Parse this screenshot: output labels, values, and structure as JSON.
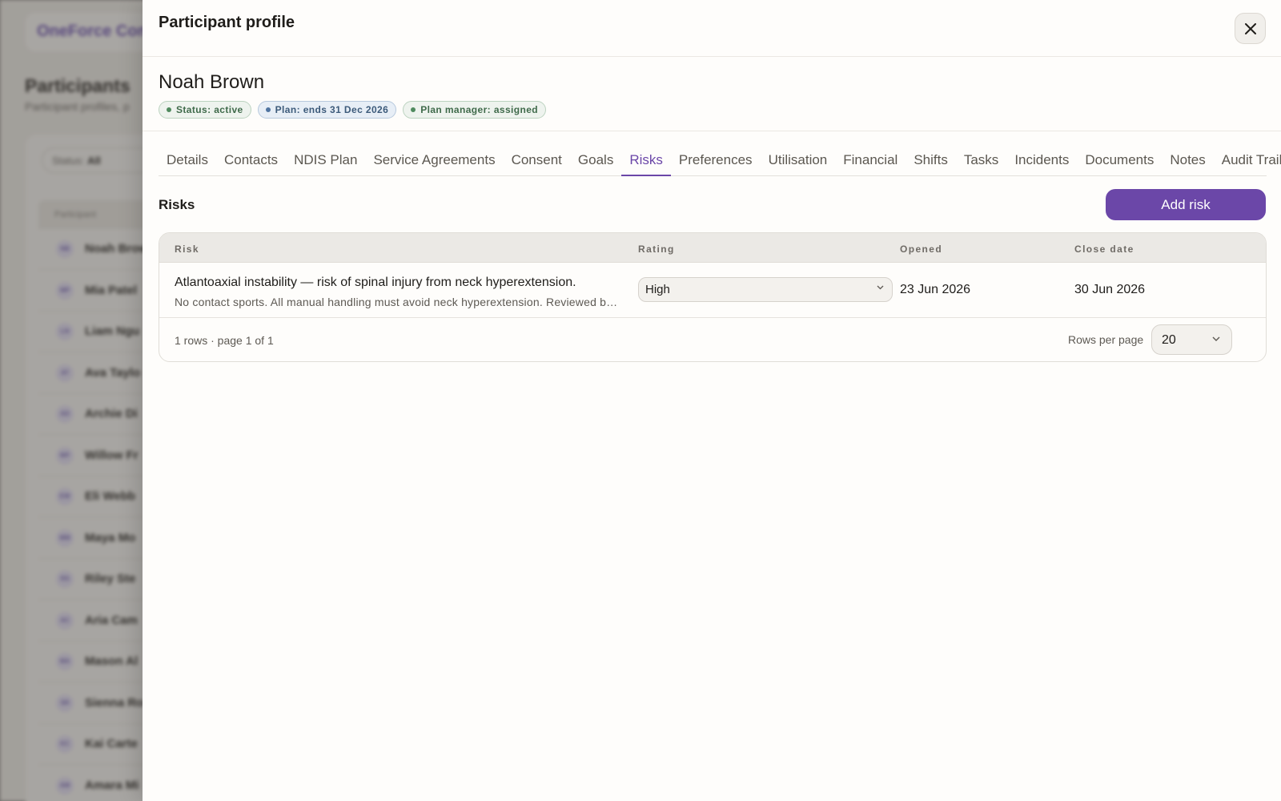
{
  "background": {
    "brand": "OneForce Con",
    "title": "Participants",
    "subtitle": "Participant profiles, p",
    "filter_label": "Status:",
    "filter_value": "All",
    "table_header": "Participant",
    "rows": [
      {
        "initials": "NB",
        "name": "Noah Brow"
      },
      {
        "initials": "MP",
        "name": "Mia Patel"
      },
      {
        "initials": "LN",
        "name": "Liam Ngu"
      },
      {
        "initials": "AT",
        "name": "Ava Taylo"
      },
      {
        "initials": "AD",
        "name": "Archie Di"
      },
      {
        "initials": "WF",
        "name": "Willow Fr"
      },
      {
        "initials": "EW",
        "name": "Eli Webb"
      },
      {
        "initials": "MM",
        "name": "Maya Mo"
      },
      {
        "initials": "RS",
        "name": "Riley Ste"
      },
      {
        "initials": "AC",
        "name": "Aria Cam"
      },
      {
        "initials": "MA",
        "name": "Mason Al"
      },
      {
        "initials": "SR",
        "name": "Sienna Ro"
      },
      {
        "initials": "KC",
        "name": "Kai Carte"
      },
      {
        "initials": "AM",
        "name": "Amara Mi"
      }
    ]
  },
  "drawer": {
    "title": "Participant profile",
    "close_icon": "close-icon",
    "participant_name": "Noah Brown",
    "chips": [
      {
        "label": "Status: active",
        "variant": "green"
      },
      {
        "label": "Plan: ends 31 Dec 2026",
        "variant": "blue"
      },
      {
        "label": "Plan manager: assigned",
        "variant": "green"
      }
    ],
    "tabs": [
      {
        "label": "Details",
        "active": false
      },
      {
        "label": "Contacts",
        "active": false
      },
      {
        "label": "NDIS Plan",
        "active": false
      },
      {
        "label": "Service Agreements",
        "active": false
      },
      {
        "label": "Consent",
        "active": false
      },
      {
        "label": "Goals",
        "active": false
      },
      {
        "label": "Risks",
        "active": true
      },
      {
        "label": "Preferences",
        "active": false
      },
      {
        "label": "Utilisation",
        "active": false
      },
      {
        "label": "Financial",
        "active": false
      },
      {
        "label": "Shifts",
        "active": false
      },
      {
        "label": "Tasks",
        "active": false
      },
      {
        "label": "Incidents",
        "active": false
      },
      {
        "label": "Documents",
        "active": false
      },
      {
        "label": "Notes",
        "active": false
      },
      {
        "label": "Audit Trail",
        "active": false
      }
    ],
    "section_title": "Risks",
    "add_button": "Add risk",
    "table": {
      "headers": {
        "risk": "Risk",
        "rating": "Rating",
        "opened": "Opened",
        "close_date": "Close date"
      },
      "rows": [
        {
          "title": "Atlantoaxial instability — risk of spinal injury from neck hyperextension.",
          "description": "No contact sports. All manual handling must avoid neck hyperextension. Reviewed by…",
          "rating": "High",
          "opened": "23 Jun 2026",
          "close_date": "30 Jun 2026"
        }
      ],
      "footer_info": "1 rows · page 1 of 1",
      "rows_per_page_label": "Rows per page",
      "rows_per_page_value": "20"
    }
  },
  "colors": {
    "accent": "#6b47a8",
    "status_green": "#4f8a5e",
    "plan_blue": "#4f74a0"
  }
}
